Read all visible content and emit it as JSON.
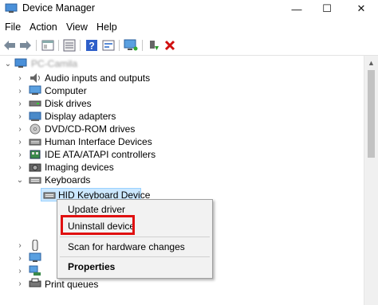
{
  "window": {
    "title": "Device Manager",
    "minimize": "—",
    "maximize": "☐",
    "close": "✕"
  },
  "menu": [
    "File",
    "Action",
    "View",
    "Help"
  ],
  "toolbar": [
    "back-icon",
    "forward-icon",
    "properties-icon",
    "show-hidden-icon",
    "help-icon",
    "view-icon",
    "monitor-icon",
    "add-driver-icon",
    "delete-icon"
  ],
  "tree": {
    "root": "PC-Camila",
    "categories": [
      "Audio inputs and outputs",
      "Computer",
      "Disk drives",
      "Display adapters",
      "DVD/CD-ROM drives",
      "Human Interface Devices",
      "IDE ATA/ATAPI controllers",
      "Imaging devices",
      "Keyboards"
    ],
    "selected_device": "HID Keyboard Device",
    "partial_bottom": "Print queues"
  },
  "context_menu": {
    "update": "Update driver",
    "uninstall": "Uninstall device",
    "scan": "Scan for hardware changes",
    "properties": "Properties"
  },
  "colors": {
    "selection": "#cce8ff",
    "highlight": "#e01010"
  }
}
